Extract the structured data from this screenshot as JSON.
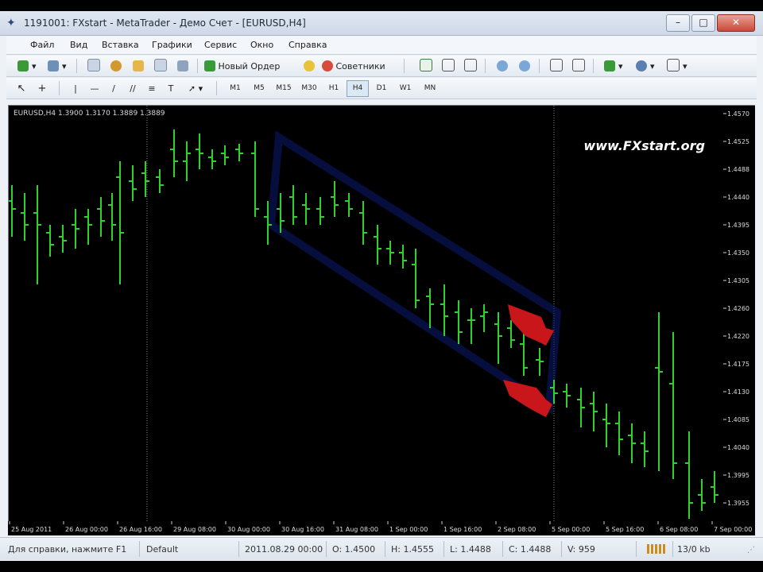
{
  "window": {
    "title": "1191001: FXstart - MetaTrader - Демо Счет - [EURUSD,H4]",
    "controls": [
      "–",
      "□",
      "✕"
    ]
  },
  "menu": [
    "Файл",
    "Вид",
    "Вставка",
    "Графики",
    "Сервис",
    "Окно",
    "Справка"
  ],
  "toolbar": {
    "new_order_label": "Новый Ордер",
    "experts_label": "Советники"
  },
  "chart": {
    "symbol_info": "EURUSD,H4  1.3900 1.3170 1.3889 1.3889",
    "watermark": "www.FXstart.org",
    "price_labels": [
      "1.4570",
      "1.4525",
      "1.4488",
      "1.4440",
      "1.4395",
      "1.4350",
      "1.4305",
      "1.4260",
      "1.4220",
      "1.4175",
      "1.4130",
      "1.4085",
      "1.4040",
      "1.3995",
      "1.3955"
    ],
    "time_labels": [
      "25 Aug 2011",
      "26 Aug 00:00",
      "26 Aug 16:00",
      "29 Aug 08:00",
      "30 Aug 00:00",
      "30 Aug 16:00",
      "31 Aug 08:00",
      "1 Sep 00:00",
      "1 Sep 16:00",
      "2 Sep 08:00",
      "5 Sep 00:00",
      "5 Sep 16:00",
      "6 Sep 08:00",
      "7 Sep 00:00"
    ],
    "bar_color": "#2fd12f",
    "arrow_color": "#c8161a",
    "channel_color": "#0a1a6e"
  },
  "status": {
    "help": "Для справки, нажмите F1",
    "profile": "Default",
    "datetime": "2011.08.29 00:00",
    "open": "O: 1.4500",
    "high": "H: 1.4555",
    "low": "L: 1.4488",
    "close": "C: 1.4488",
    "volume": "V: 959",
    "traffic": "13/0 kb"
  }
}
